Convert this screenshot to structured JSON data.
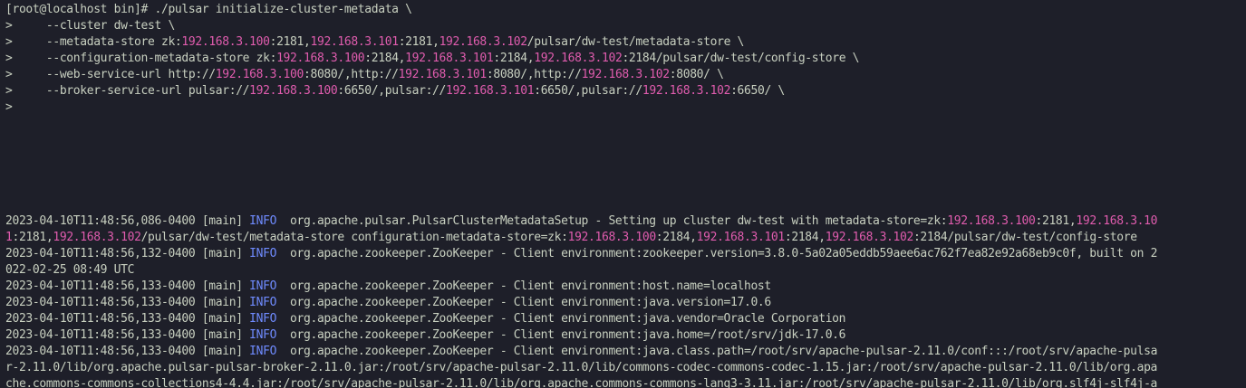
{
  "terminal": {
    "colors": {
      "background": "#1e1f29",
      "foreground": "#c8d0c0",
      "ip_highlight": "#e05cae",
      "info_level": "#6f8bff"
    },
    "command_lines": [
      [
        {
          "t": "[root@localhost bin]# ./pulsar initialize-cluster-metadata \\"
        }
      ],
      [
        {
          "t": ">     --cluster dw-test \\"
        }
      ],
      [
        {
          "t": ">     --metadata-store zk:"
        },
        {
          "t": "192.168.3.100",
          "c": "ip"
        },
        {
          "t": ":2181,"
        },
        {
          "t": "192.168.3.101",
          "c": "ip"
        },
        {
          "t": ":2181,"
        },
        {
          "t": "192.168.3.102",
          "c": "ip"
        },
        {
          "t": "/pulsar/dw-test/metadata-store \\"
        }
      ],
      [
        {
          "t": ">     --configuration-metadata-store zk:"
        },
        {
          "t": "192.168.3.100",
          "c": "ip"
        },
        {
          "t": ":2184,"
        },
        {
          "t": "192.168.3.101",
          "c": "ip"
        },
        {
          "t": ":2184,"
        },
        {
          "t": "192.168.3.102",
          "c": "ip"
        },
        {
          "t": ":2184/pulsar/dw-test/config-store \\"
        }
      ],
      [
        {
          "t": ">     --web-service-url http://"
        },
        {
          "t": "192.168.3.100",
          "c": "ip"
        },
        {
          "t": ":8080/,http://"
        },
        {
          "t": "192.168.3.101",
          "c": "ip"
        },
        {
          "t": ":8080/,http://"
        },
        {
          "t": "192.168.3.102",
          "c": "ip"
        },
        {
          "t": ":8080/ \\"
        }
      ],
      [
        {
          "t": ">     --broker-service-url pulsar://"
        },
        {
          "t": "192.168.3.100",
          "c": "ip"
        },
        {
          "t": ":6650/,pulsar://"
        },
        {
          "t": "192.168.3.101",
          "c": "ip"
        },
        {
          "t": ":6650/,pulsar://"
        },
        {
          "t": "192.168.3.102",
          "c": "ip"
        },
        {
          "t": ":6650/ \\"
        }
      ],
      [
        {
          "t": ">"
        }
      ]
    ],
    "log_lines": [
      [
        {
          "t": "2023-04-10T11:48:56,086-0400 [main] "
        },
        {
          "t": "INFO",
          "c": "info"
        },
        {
          "t": "  org.apache.pulsar.PulsarClusterMetadataSetup - Setting up cluster dw-test with metadata-store=zk:"
        },
        {
          "t": "192.168.3.100",
          "c": "ip"
        },
        {
          "t": ":2181,"
        },
        {
          "t": "192.168.3.10",
          "c": "ip"
        }
      ],
      [
        {
          "t": "1",
          "c": "ip"
        },
        {
          "t": ":2181,"
        },
        {
          "t": "192.168.3.102",
          "c": "ip"
        },
        {
          "t": "/pulsar/dw-test/metadata-store configuration-metadata-store=zk:"
        },
        {
          "t": "192.168.3.100",
          "c": "ip"
        },
        {
          "t": ":2184,"
        },
        {
          "t": "192.168.3.101",
          "c": "ip"
        },
        {
          "t": ":2184,"
        },
        {
          "t": "192.168.3.102",
          "c": "ip"
        },
        {
          "t": ":2184/pulsar/dw-test/config-store"
        }
      ],
      [
        {
          "t": "2023-04-10T11:48:56,132-0400 [main] "
        },
        {
          "t": "INFO",
          "c": "info"
        },
        {
          "t": "  org.apache.zookeeper.ZooKeeper - Client environment:zookeeper.version=3.8.0-5a02a05eddb59aee6ac762f7ea82e92a68eb9c0f, built on 2"
        }
      ],
      [
        {
          "t": "022-02-25 08:49 UTC"
        }
      ],
      [
        {
          "t": "2023-04-10T11:48:56,133-0400 [main] "
        },
        {
          "t": "INFO",
          "c": "info"
        },
        {
          "t": "  org.apache.zookeeper.ZooKeeper - Client environment:host.name=localhost"
        }
      ],
      [
        {
          "t": "2023-04-10T11:48:56,133-0400 [main] "
        },
        {
          "t": "INFO",
          "c": "info"
        },
        {
          "t": "  org.apache.zookeeper.ZooKeeper - Client environment:java.version=17.0.6"
        }
      ],
      [
        {
          "t": "2023-04-10T11:48:56,133-0400 [main] "
        },
        {
          "t": "INFO",
          "c": "info"
        },
        {
          "t": "  org.apache.zookeeper.ZooKeeper - Client environment:java.vendor=Oracle Corporation"
        }
      ],
      [
        {
          "t": "2023-04-10T11:48:56,133-0400 [main] "
        },
        {
          "t": "INFO",
          "c": "info"
        },
        {
          "t": "  org.apache.zookeeper.ZooKeeper - Client environment:java.home=/root/srv/jdk-17.0.6"
        }
      ],
      [
        {
          "t": "2023-04-10T11:48:56,133-0400 [main] "
        },
        {
          "t": "INFO",
          "c": "info"
        },
        {
          "t": "  org.apache.zookeeper.ZooKeeper - Client environment:java.class.path=/root/srv/apache-pulsar-2.11.0/conf:::/root/srv/apache-pulsa"
        }
      ],
      [
        {
          "t": "r-2.11.0/lib/org.apache.pulsar-pulsar-broker-2.11.0.jar:/root/srv/apache-pulsar-2.11.0/lib/commons-codec-commons-codec-1.15.jar:/root/srv/apache-pulsar-2.11.0/lib/org.apa"
        }
      ],
      [
        {
          "t": "che.commons-commons-collections4-4.4.jar:/root/srv/apache-pulsar-2.11.0/lib/org.apache.commons-commons-lang3-3.11.jar:/root/srv/apache-pulsar-2.11.0/lib/org.slf4j-slf4j-a"
        }
      ]
    ]
  }
}
